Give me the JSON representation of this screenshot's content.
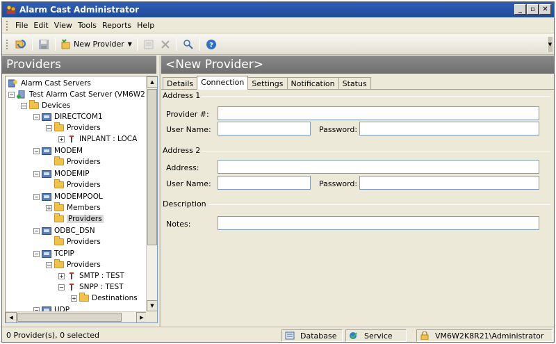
{
  "window": {
    "title": "Alarm Cast Administrator"
  },
  "menu": [
    "File",
    "Edit",
    "View",
    "Tools",
    "Reports",
    "Help"
  ],
  "toolbar": {
    "new_provider_label": "New Provider"
  },
  "left_panel": {
    "header": "Providers"
  },
  "tree": {
    "root": "Alarm Cast Servers",
    "server": "Test Alarm Cast Server (VM6W2",
    "devices": "Devices",
    "directcom": "DIRECTCOM1",
    "providers": "Providers",
    "inplant": "INPLANT : LOCA",
    "modem": "MODEM",
    "modemip": "MODEMIP",
    "modempool": "MODEMPOOL",
    "members": "Members",
    "odbc": "ODBC_DSN",
    "tcpip": "TCPIP",
    "smtp": "SMTP : TEST",
    "snpp": "SNPP : TEST",
    "destinations": "Destinations",
    "udp": "UDP"
  },
  "right_panel": {
    "header": "<New Provider>"
  },
  "tabs": [
    "Details",
    "Connection",
    "Settings",
    "Notification",
    "Status"
  ],
  "form": {
    "address1": "Address 1",
    "provider_num_label": "Provider #:",
    "user_name_label": "User Name:",
    "password_label": "Password:",
    "address2": "Address 2",
    "address_label": "Address:",
    "user_name2_label": "User Name:",
    "password2_label": "Password:",
    "description": "Description",
    "notes_label": "Notes:",
    "provider_num_value": "",
    "user_name_value": "",
    "password_value": "",
    "address_value": "",
    "user_name2_value": "",
    "password2_value": "",
    "notes_value": ""
  },
  "status": {
    "selection": "0 Provider(s), 0 selected",
    "database": "Database",
    "service": "Service",
    "user": "VM6W2K8R21\\Administrator"
  }
}
